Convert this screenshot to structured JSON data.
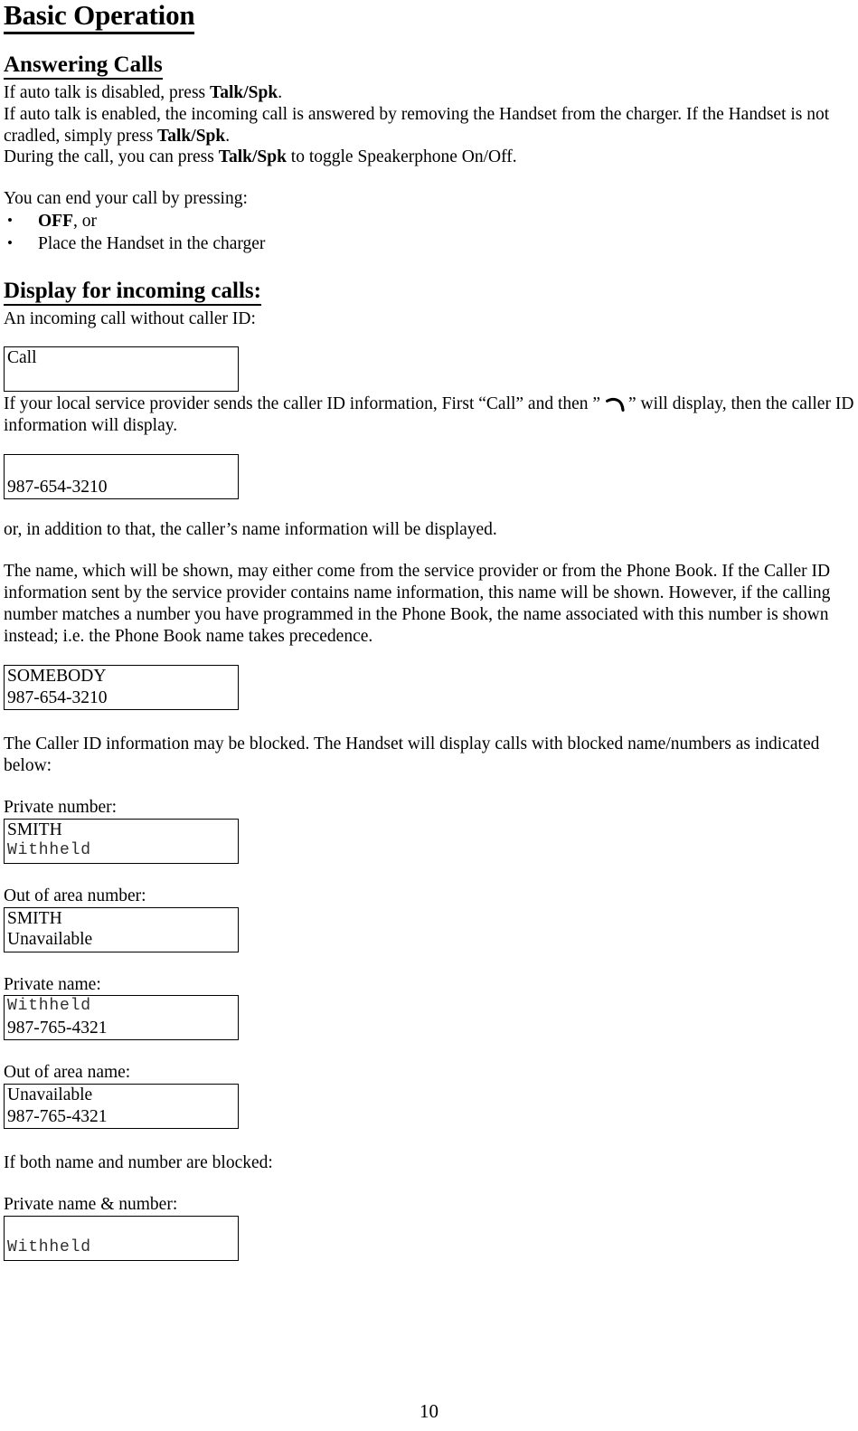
{
  "document": {
    "title": "Basic Operation",
    "page_number": "10"
  },
  "sections": {
    "answering_calls": {
      "heading": "Answering Calls",
      "line1_pre": "If auto talk is disabled, press ",
      "line1_bold": "Talk/Spk",
      "line1_post": ".",
      "line2_pre": "If auto talk is enabled, the incoming call is answered by removing the Handset from the charger. If the Handset is not cradled, simply press ",
      "line2_bold": "Talk/Spk",
      "line2_post": ".",
      "line3_pre": "During the call, you can press ",
      "line3_bold": "Talk/Spk",
      "line3_post": " to toggle Speakerphone On/Off.",
      "end_call_intro": "You can end your call by pressing:",
      "end_call_items": [
        {
          "bullet": "•",
          "bold": "OFF",
          "rest": ", or"
        },
        {
          "bullet": "•",
          "bold": "",
          "rest": "Place the Handset in the charger"
        }
      ]
    },
    "display_incoming": {
      "heading": "Display for incoming calls:",
      "intro_no_callerid": "An incoming call without caller ID:",
      "box_call": {
        "line1": "Call",
        "line2": ""
      },
      "paragraph_callerid_pre": "If your local service provider sends the caller ID information, First “Call” and then ” ",
      "paragraph_callerid_icon": "phone-handset-icon",
      "paragraph_callerid_post": "” will display, then the caller ID information will display.",
      "box_number_only": {
        "line1": "",
        "line2": "987-654-3210"
      },
      "note_name_added": "or, in addition to that, the caller’s name information will be displayed.",
      "paragraph_name_source": "The name, which will be shown, may either come from the service provider or from the Phone Book.  If the Caller ID information sent by the service provider contains name information, this name will be shown.  However, if the calling number matches a number you have programmed in the Phone Book, the name associated with this number is shown instead; i.e. the Phone Book name takes precedence.",
      "box_name_number": {
        "line1": "SOMEBODY",
        "line2": "987-654-3210"
      },
      "paragraph_blocked": "The Caller ID information may be blocked. The Handset will display calls with blocked name/numbers as indicated below:",
      "blocked_cases": [
        {
          "label": "Private number:",
          "box": {
            "line1": "SMITH",
            "line1_mono": false,
            "line2": "Withheld",
            "line2_mono": true
          }
        },
        {
          "label": "Out of area number:",
          "box": {
            "line1": "SMITH",
            "line1_mono": false,
            "line2": "Unavailable",
            "line2_mono": false
          }
        },
        {
          "label": "Private name:",
          "box": {
            "line1": "Withheld",
            "line1_mono": true,
            "line2": "987-765-4321",
            "line2_mono": false
          }
        },
        {
          "label": "Out of area name:",
          "box": {
            "line1": "Unavailable",
            "line1_mono": false,
            "line2": "987-765-4321",
            "line2_mono": false
          }
        }
      ],
      "both_blocked_intro": "If both name and number are blocked:",
      "both_blocked_label": "Private name & number:",
      "box_both_blocked": {
        "line1": "",
        "line1_mono": false,
        "line2": "Withheld",
        "line2_mono": true
      }
    }
  },
  "colors": {
    "text": "#000000",
    "box_border": "#000000",
    "lcd_mono_text": "#303030",
    "background": "#ffffff"
  }
}
